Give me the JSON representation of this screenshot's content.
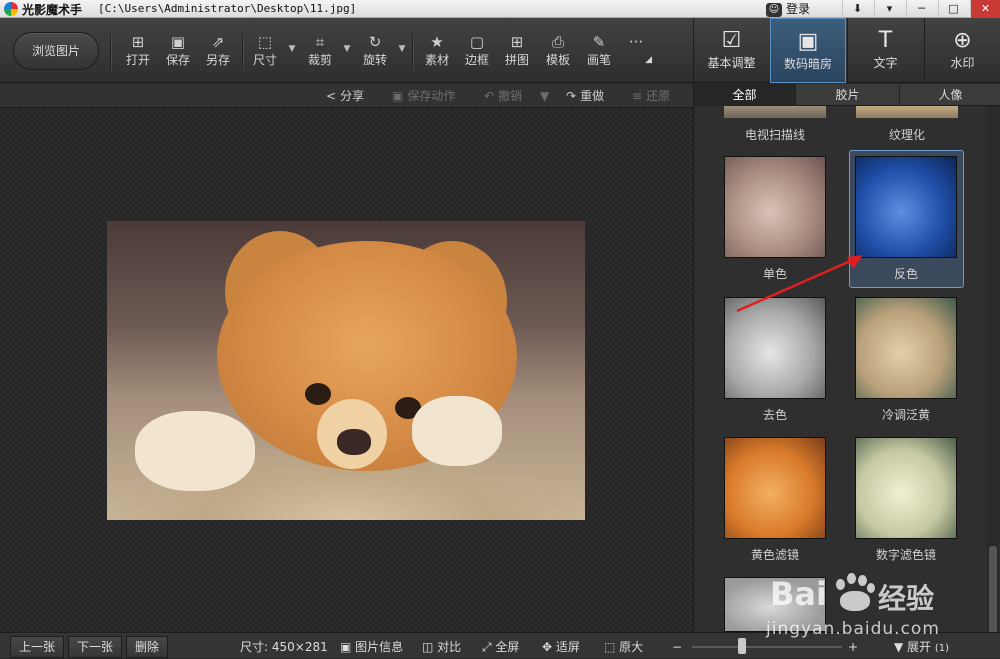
{
  "titlebar": {
    "app_name": "光影魔术手",
    "path": "[C:\\Users\\Administrator\\Desktop\\11.jpg]",
    "login": "登录",
    "buttons": [
      "⬇",
      "▾",
      "─",
      "□",
      "✕"
    ]
  },
  "toolbar": {
    "browse": "浏览图片",
    "tools": [
      {
        "label": "打开",
        "icon": "open-icon",
        "glyph": "⊞"
      },
      {
        "label": "保存",
        "icon": "save-icon",
        "glyph": "▣"
      },
      {
        "label": "另存",
        "icon": "save-as-icon",
        "glyph": "⇗"
      },
      {
        "label": "尺寸",
        "icon": "resize-icon",
        "glyph": "⬚"
      },
      {
        "label": "裁剪",
        "icon": "crop-icon",
        "glyph": "⌗"
      },
      {
        "label": "旋转",
        "icon": "rotate-icon",
        "glyph": "↻"
      },
      {
        "label": "素材",
        "icon": "material-icon",
        "glyph": "★"
      },
      {
        "label": "边框",
        "icon": "border-icon",
        "glyph": "▢"
      },
      {
        "label": "拼图",
        "icon": "collage-icon",
        "glyph": "⊞"
      },
      {
        "label": "模板",
        "icon": "template-icon",
        "glyph": "⎙"
      },
      {
        "label": "画笔",
        "icon": "brush-icon",
        "glyph": "✎"
      },
      {
        "label": "",
        "icon": "more-icon",
        "glyph": "···"
      }
    ],
    "tabs": [
      {
        "label": "基本调整",
        "icon": "basic-adjust-icon",
        "glyph": "☑"
      },
      {
        "label": "数码暗房",
        "icon": "darkroom-icon",
        "glyph": "▣"
      },
      {
        "label": "文字",
        "icon": "text-icon",
        "glyph": "T"
      },
      {
        "label": "水印",
        "icon": "watermark-icon",
        "glyph": "⊕"
      }
    ]
  },
  "subbar": {
    "share": "分享",
    "save_action": "保存动作",
    "undo": "撤销",
    "redo": "重做",
    "restore": "还原"
  },
  "filter_tabs": [
    "全部",
    "胶片",
    "人像"
  ],
  "filters": {
    "top_labels": [
      "电视扫描线",
      "纹理化"
    ],
    "items": [
      {
        "label": "单色"
      },
      {
        "label": "反色"
      },
      {
        "label": "去色"
      },
      {
        "label": "冷调泛黄"
      },
      {
        "label": "黄色滤镜"
      },
      {
        "label": "数字滤色镜"
      }
    ]
  },
  "status": {
    "prev": "上一张",
    "next": "下一张",
    "delete": "删除",
    "size": "尺寸: 450×281",
    "info": "图片信息",
    "compare": "对比",
    "fullscreen": "全屏",
    "fit": "适屏",
    "original": "原大",
    "zoom_minus": "−",
    "zoom_plus": "+",
    "expand": "展开",
    "expand_count": "(1)"
  },
  "zoom": {
    "level": 0.33
  },
  "watermark": {
    "brand": "Bai",
    "brand2": "经验",
    "url": "jingyan.baidu.com"
  },
  "colors": {
    "accent": "#3c5e7c",
    "highlight": "#6b9bd1",
    "arrow": "#e02020"
  }
}
